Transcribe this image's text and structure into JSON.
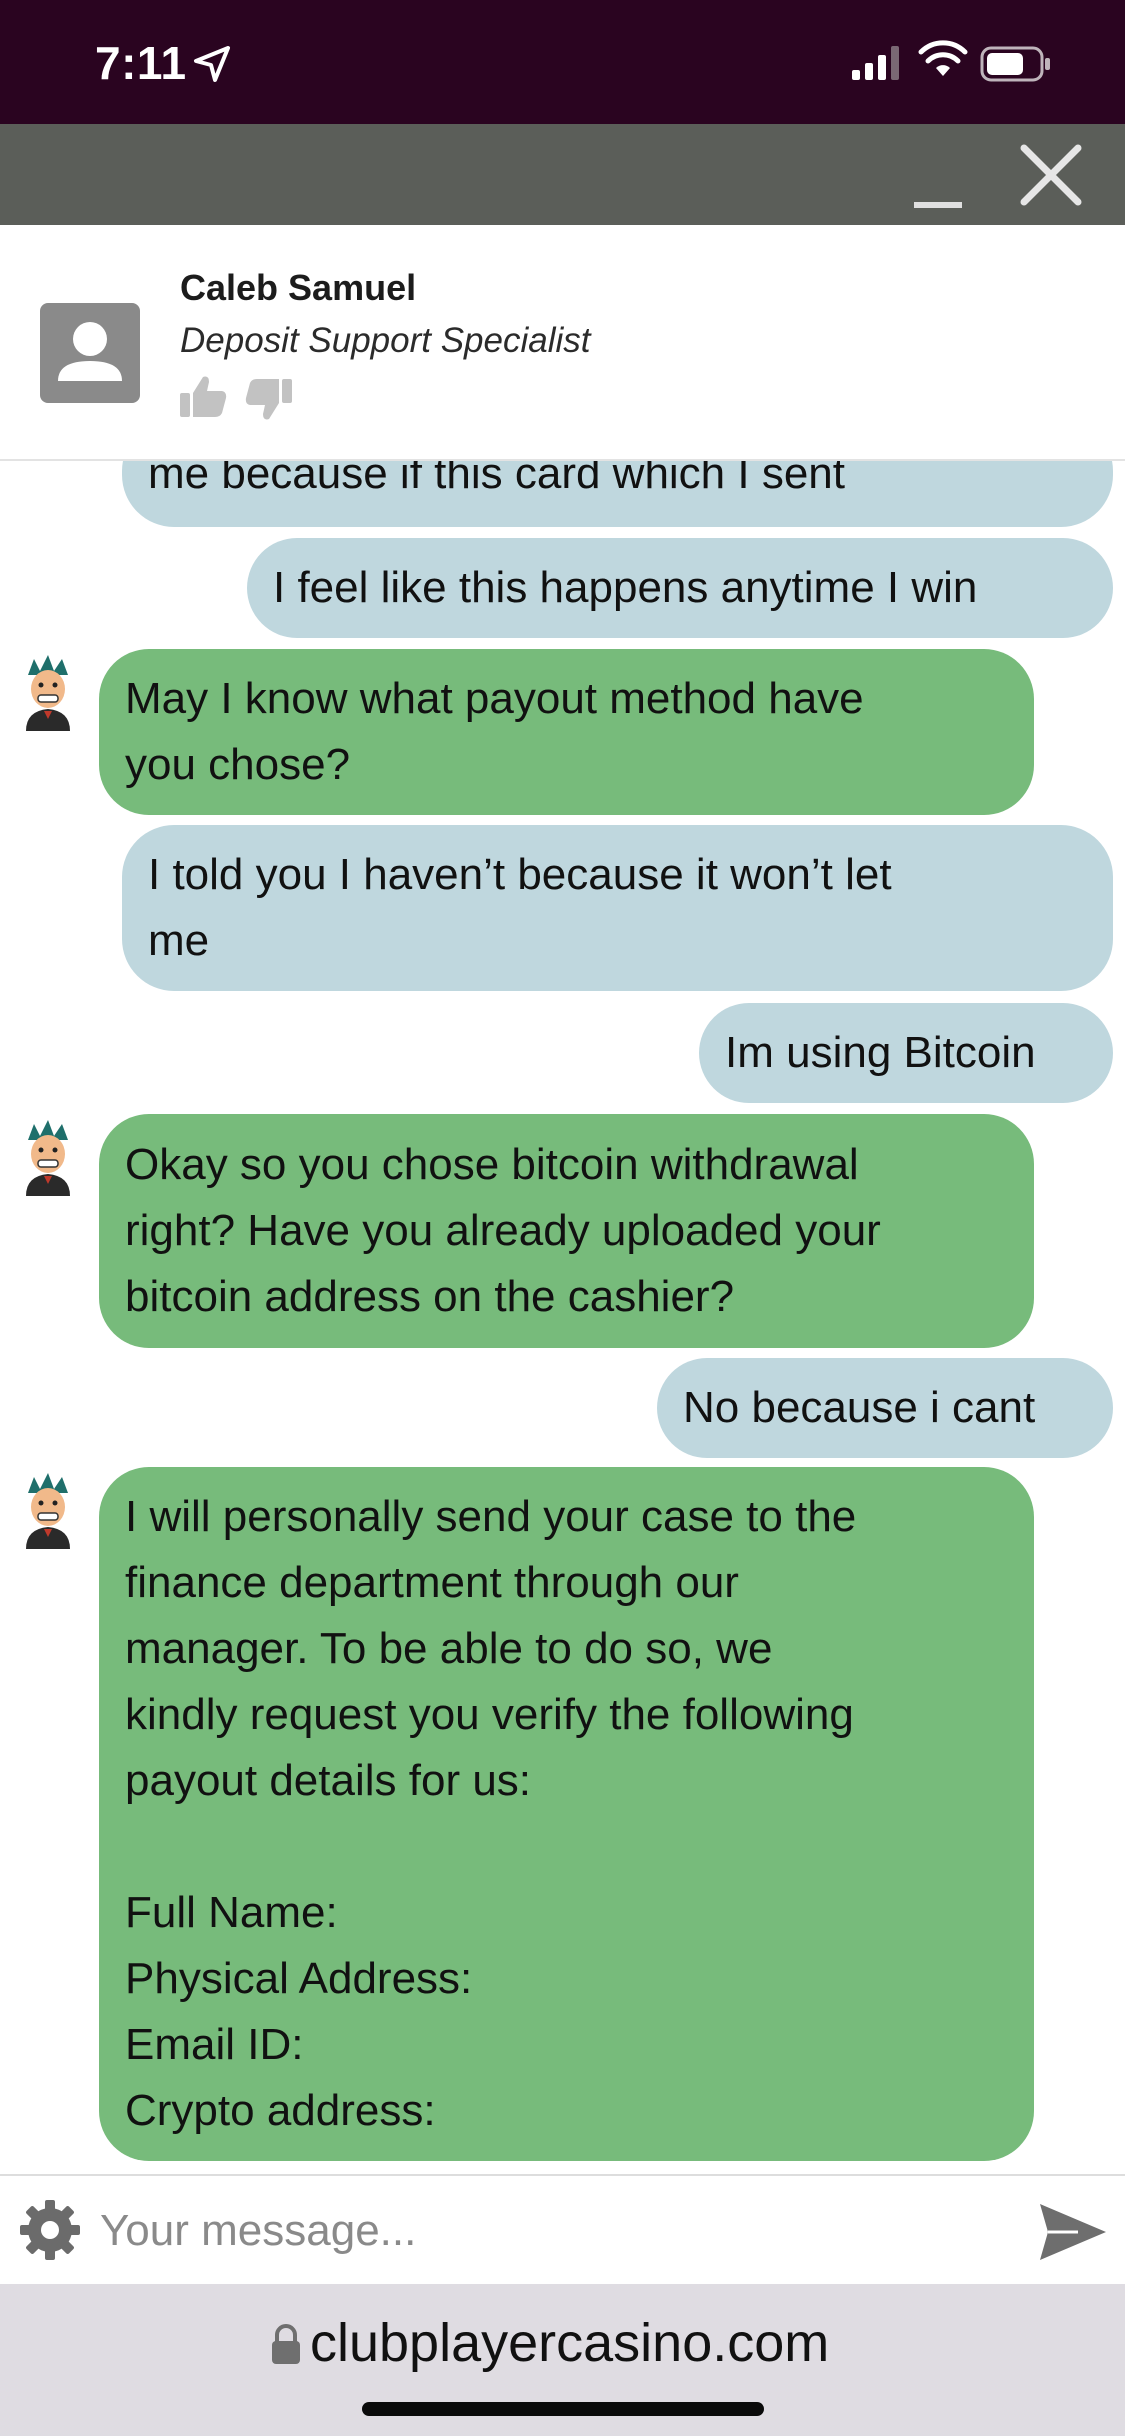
{
  "status_bar": {
    "time": "7:11"
  },
  "agent": {
    "name": "Caleb Samuel",
    "role": "Deposit Support Specialist"
  },
  "messages": [
    {
      "sender": "user",
      "text": "me because if this card which I sent"
    },
    {
      "sender": "user",
      "text": "I feel like this happens anytime I win"
    },
    {
      "sender": "agent",
      "text": "May I know what payout method have\nyou chose?"
    },
    {
      "sender": "user",
      "text": "I told you I haven’t because it won’t let\nme"
    },
    {
      "sender": "user",
      "text": "Im using Bitcoin"
    },
    {
      "sender": "agent",
      "text": "Okay so you chose bitcoin withdrawal\nright? Have you already uploaded your\nbitcoin address on the cashier?"
    },
    {
      "sender": "user",
      "text": "No because i cant"
    },
    {
      "sender": "agent",
      "text": "I will personally send your case to the\nfinance department through our\nmanager. To be able to do so, we\nkindly request you verify the following\npayout details for us:\n\nFull Name:\nPhysical Address:\nEmail ID:\nCrypto address:"
    }
  ],
  "composer": {
    "placeholder": "Your message..."
  },
  "browser": {
    "url": "clubplayercasino.com"
  },
  "colors": {
    "status_bar_bg": "#2a0420",
    "window_bar_bg": "#5b5e59",
    "user_bubble": "#bfd7de",
    "agent_bubble": "#77bb7b",
    "browser_bar_bg": "#dfdce2"
  }
}
